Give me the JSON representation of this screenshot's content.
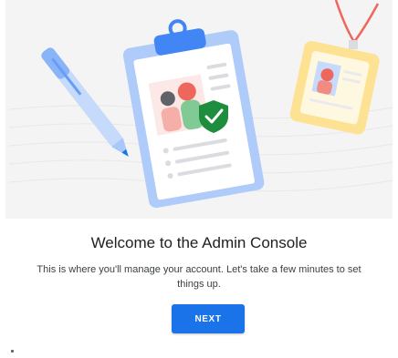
{
  "welcome": {
    "title": "Welcome to the Admin Console",
    "description": "This is where you'll manage your account. Let's take a few minutes to set things up.",
    "next_label": "NEXT"
  },
  "colors": {
    "primary": "#1a73e8",
    "hero_background": "#f4f4f4",
    "clipboard": "#a8c7fa",
    "check_green": "#1e8e3e",
    "badge_yellow": "#fde293",
    "lanyard_red": "#d93025"
  },
  "icons": [
    "pen-icon",
    "clipboard-icon",
    "checkmark-shield-icon",
    "id-badge-icon"
  ]
}
